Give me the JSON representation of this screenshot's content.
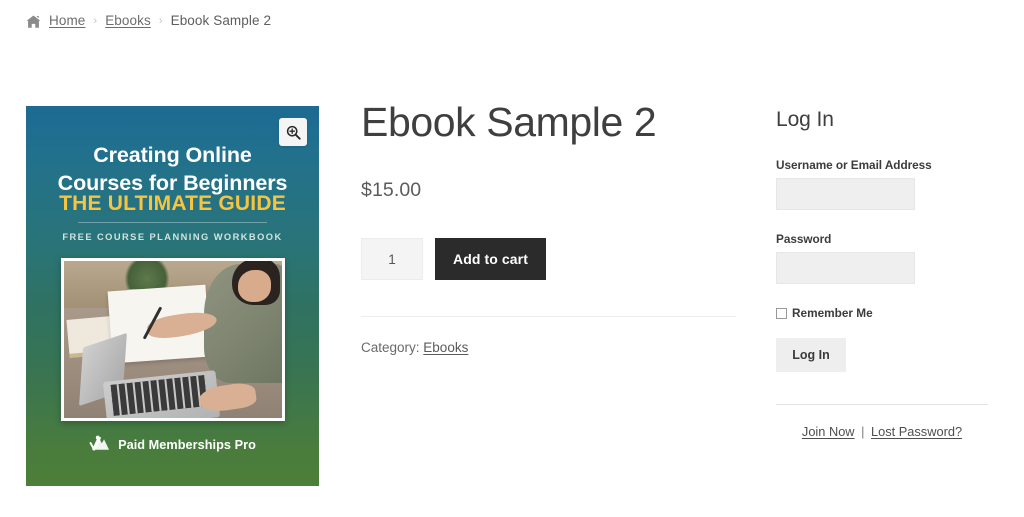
{
  "breadcrumb": {
    "home_icon": "home-icon",
    "items": [
      {
        "label": "Home",
        "type": "link"
      },
      {
        "label": "Ebooks",
        "type": "link"
      },
      {
        "label": "Ebook Sample 2",
        "type": "current"
      }
    ],
    "separator": "›"
  },
  "product": {
    "title": "Ebook Sample 2",
    "price": "$15.00",
    "quantity_value": "1",
    "add_to_cart_label": "Add to cart",
    "category_label": "Category:",
    "category_value": "Ebooks",
    "zoom_icon": "magnifier-plus-icon"
  },
  "cover": {
    "title_line1": "Creating Online",
    "title_line2": "Courses for Beginners",
    "subtitle": "THE ULTIMATE GUIDE",
    "tagline": "FREE COURSE PLANNING WORKBOOK",
    "brand": "Paid Memberships Pro",
    "brand_icon": "pmp-mountain-logo-icon",
    "gradient_top": "#1d6a93",
    "gradient_mid": "#2f7263",
    "gradient_bottom": "#4d7f39",
    "accent_yellow": "#f5c542"
  },
  "login": {
    "heading": "Log In",
    "username_label": "Username or Email Address",
    "username_value": "",
    "password_label": "Password",
    "password_value": "",
    "remember_label": "Remember Me",
    "submit_label": "Log In",
    "join_label": "Join Now",
    "link_separator": "|",
    "lost_password_label": "Lost Password?"
  },
  "colors": {
    "button_dark": "#2b2b2b",
    "input_gray": "#efefef",
    "text_primary": "#3a3a3a",
    "text_muted": "#6d6d6d",
    "divider": "#ededed"
  }
}
